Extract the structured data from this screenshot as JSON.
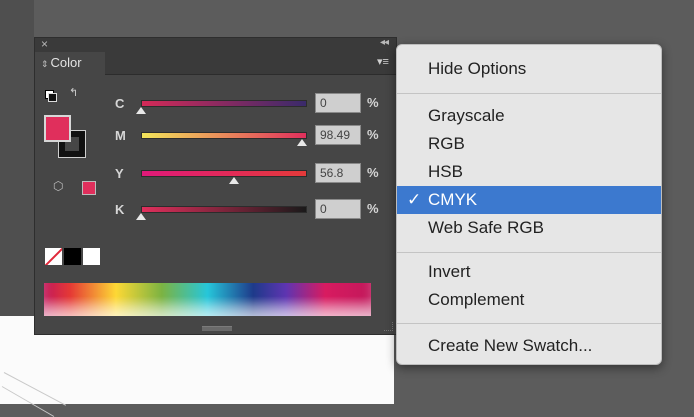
{
  "panel": {
    "tab_label": "Color",
    "close_glyph": "×",
    "collapse_glyph": "◂◂",
    "menu_glyph": "▾≡",
    "fill_color": "#e02f5c",
    "sliders": [
      {
        "label": "C",
        "value": "0",
        "unit": "%",
        "fraction": 0.0,
        "gradient": "linear-gradient(to right,#d42a58,#3a2a6a)"
      },
      {
        "label": "M",
        "value": "98.49",
        "unit": "%",
        "fraction": 0.98,
        "gradient": "linear-gradient(to right,#f2e45a,#e02f5c)"
      },
      {
        "label": "Y",
        "value": "56.8",
        "unit": "%",
        "fraction": 0.57,
        "gradient": "linear-gradient(to right,#e0197a,#e43a3a)"
      },
      {
        "label": "K",
        "value": "0",
        "unit": "%",
        "fraction": 0.0,
        "gradient": "linear-gradient(to right,#e02f5c,#1a1a1a)"
      }
    ]
  },
  "menu": {
    "hide_options": "Hide Options",
    "modes": [
      {
        "label": "Grayscale",
        "selected": false
      },
      {
        "label": "RGB",
        "selected": false
      },
      {
        "label": "HSB",
        "selected": false
      },
      {
        "label": "CMYK",
        "selected": true
      },
      {
        "label": "Web Safe RGB",
        "selected": false
      }
    ],
    "check_glyph": "✓",
    "invert": "Invert",
    "complement": "Complement",
    "create_swatch": "Create New Swatch..."
  },
  "colors": {
    "accent": "#3c79cf",
    "panel_bg": "#464646"
  }
}
